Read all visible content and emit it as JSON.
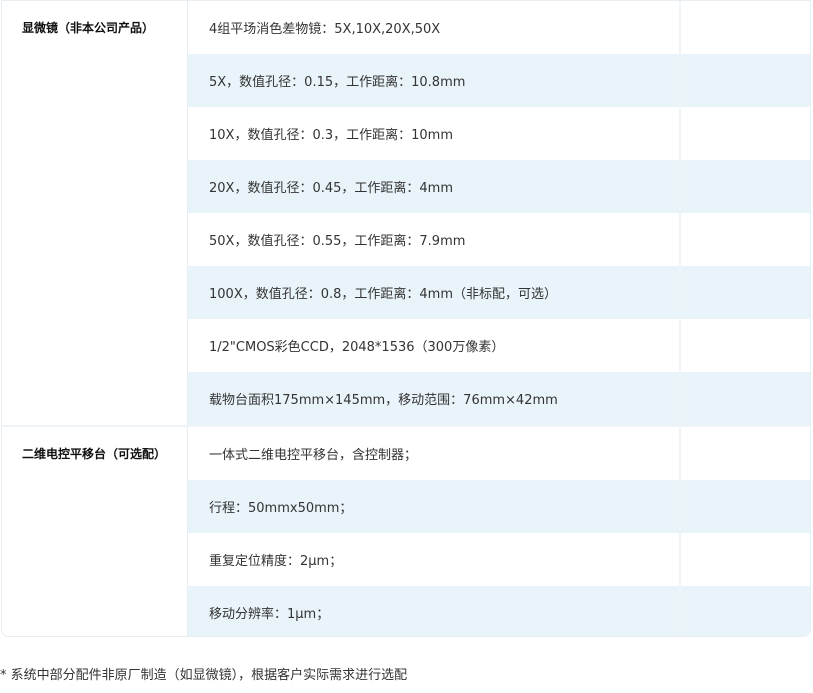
{
  "groups": [
    {
      "category": "显微镜（非本公司产品）",
      "rows": [
        {
          "spec": "4组平场消色差物镜：5X,10X,20X,50X",
          "note": ""
        },
        {
          "spec": "5X，数值孔径：0.15，工作距离：10.8mm",
          "note": ""
        },
        {
          "spec": "10X，数值孔径：0.3，工作距离：10mm",
          "note": ""
        },
        {
          "spec": "20X，数值孔径：0.45，工作距离：4mm",
          "note": ""
        },
        {
          "spec": "50X，数值孔径：0.55，工作距离：7.9mm",
          "note": ""
        },
        {
          "spec": "100X，数值孔径：0.8，工作距离：4mm（非标配，可选）",
          "note": ""
        },
        {
          "spec": "1/2\"CMOS彩色CCD，2048*1536（300万像素）",
          "note": ""
        },
        {
          "spec": "载物台面积175mm×145mm，移动范围：76mm×42mm",
          "note": ""
        }
      ]
    },
    {
      "category": "二维电控平移台（可选配）",
      "rows": [
        {
          "spec": "一体式二维电控平移台，含控制器；",
          "note": ""
        },
        {
          "spec": "行程：50mmx50mm；",
          "note": ""
        },
        {
          "spec": "重复定位精度：2μm；",
          "note": ""
        },
        {
          "spec": "移动分辨率：1μm；",
          "note": ""
        }
      ]
    }
  ],
  "footnote": "* 系统中部分配件非原厂制造（如显微镜），根据客户实际需求进行选配",
  "colors": {
    "row_alt": "#e9f4fa",
    "row_white": "#ffffff",
    "border": "#e6eef4"
  }
}
